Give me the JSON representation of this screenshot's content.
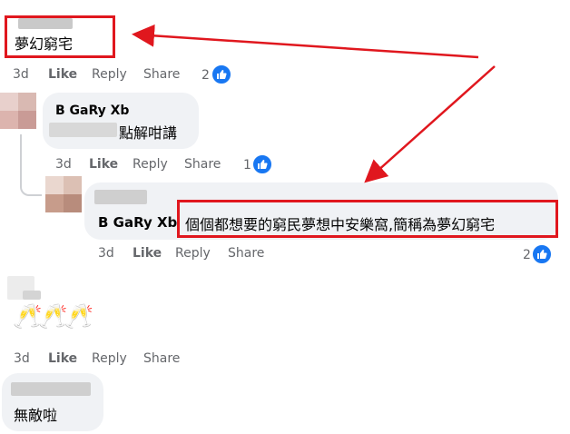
{
  "comments": [
    {
      "text": "夢幻窮宅",
      "meta": {
        "time": "3d",
        "like": "Like",
        "reply": "Reply",
        "share": "Share"
      },
      "reaction_count": "2"
    },
    {
      "author": "B GaRy Xb",
      "text": "點解咁講",
      "meta": {
        "time": "3d",
        "like": "Like",
        "reply": "Reply",
        "share": "Share"
      },
      "reaction_count": "1"
    },
    {
      "mention": "B GaRy Xb",
      "text": "個個都想要的窮民夢想中安樂窩,簡稱為夢幻窮宅",
      "meta": {
        "time": "3d",
        "like": "Like",
        "reply": "Reply",
        "share": "Share"
      },
      "reaction_count": "2"
    },
    {
      "emoji": "🥂🥂🥂",
      "meta": {
        "time": "3d",
        "like": "Like",
        "reply": "Reply",
        "share": "Share"
      }
    },
    {
      "text": "無敵啦"
    }
  ],
  "colors": {
    "accent": "#1877f2",
    "annotation": "#e0171e",
    "bubble": "#f0f2f5",
    "meta": "#65676b"
  },
  "icons": [
    "thumbs-up-icon",
    "arrow-annotation"
  ]
}
